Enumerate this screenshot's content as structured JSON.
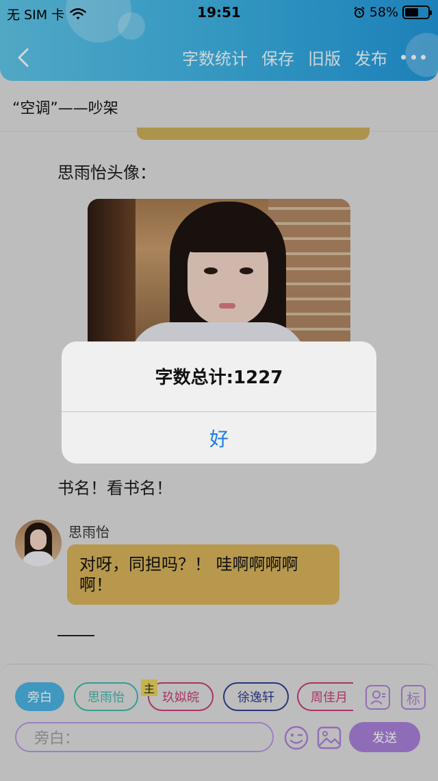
{
  "status_bar": {
    "carrier": "无 SIM 卡",
    "time": "19:51",
    "battery_percent": "58%",
    "battery_level": 0.58
  },
  "navbar": {
    "actions": [
      "字数统计",
      "保存",
      "旧版",
      "发布"
    ]
  },
  "story": {
    "title": "“空调”——吵架"
  },
  "content": {
    "avatar_caption": "思雨怡头像：",
    "narration_1": "书名！看书名！",
    "message": {
      "sender": "思雨怡",
      "text": "对呀，同担吗？！ 哇啊啊啊啊啊！"
    },
    "trailing": "——"
  },
  "alert": {
    "message": "字数总计:1227",
    "ok_label": "好"
  },
  "composer": {
    "chips": [
      "旁白",
      "思雨怡",
      "玖姒皖",
      "徐逸轩",
      "周佳月"
    ],
    "main_badge": "主",
    "mark_label": "标",
    "input_placeholder": "旁白：",
    "send_label": "发送"
  },
  "colors": {
    "header_accent": "#3aaee0",
    "bubble_bg": "#d5b25a",
    "send_bg": "#a77ed6",
    "alert_button": "#1a7ce8"
  }
}
